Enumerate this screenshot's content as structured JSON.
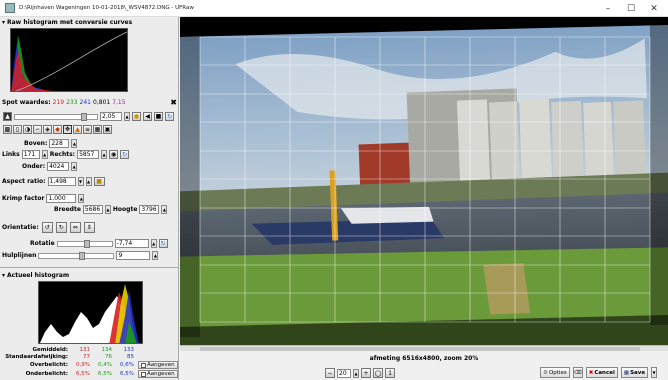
{
  "window": {
    "title": "D:\\Rijnhaven Wageningen 10-01-2018\\_WSV4872.DNG - UFRaw"
  },
  "raw_histogram": {
    "header": "Raw histogram met conversie curves"
  },
  "spot": {
    "label": "Spot waardes:",
    "r": "219",
    "g": "233",
    "b": "241",
    "lum": "0,801",
    "extra": "7,15"
  },
  "exposure": {
    "value": "2,05"
  },
  "crop": {
    "top_label": "Boven:",
    "top_value": "228",
    "left_label": "Links",
    "left_value": "171",
    "right_label": "Rechts:",
    "right_value": "5857",
    "bottom_label": "Onder:",
    "bottom_value": "4024",
    "aspect_label": "Aspect ratio:",
    "aspect_value": "1,498",
    "shrink_label": "Krimp factor",
    "shrink_value": "1,000",
    "width_label": "Breedte",
    "width_value": "5686",
    "height_label": "Hoogte",
    "height_value": "3796",
    "orientation_label": "Orientatie:",
    "rotation_label": "Rotatie",
    "rotation_value": "-7,74",
    "gridlines_label": "Hulplijnen",
    "gridlines_value": "9"
  },
  "live_histogram": {
    "header": "Actueel histogram"
  },
  "stats": {
    "avg_label": "Gemiddeld:",
    "avg": [
      "131",
      "134",
      "133"
    ],
    "std_label": "Standaardafwijking:",
    "std": [
      "77",
      "76",
      "85"
    ],
    "over_label": "Overbelicht:",
    "over": [
      "0,9%",
      "0,4%",
      "0,6%"
    ],
    "over_btn": "Aangeven",
    "under_label": "Onderbelicht:",
    "under": [
      "6,5%",
      "6,5%",
      "6,5%"
    ],
    "under_btn": "Aangeven"
  },
  "status": "afmeting 6516x4800, zoom 20%",
  "bottom": {
    "zoom_value": "20",
    "options_label": "Opties",
    "cancel_label": "Cancel",
    "save_label": "Save"
  },
  "colors": {
    "red": "#d42020",
    "green": "#1a9c1a",
    "blue": "#2030d0"
  }
}
